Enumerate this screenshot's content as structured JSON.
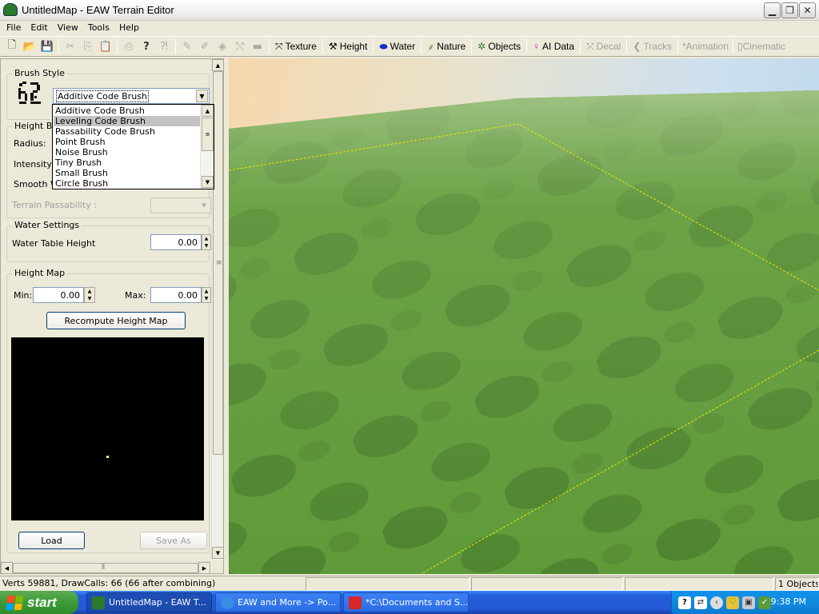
{
  "window": {
    "title": "UntitledMap - EAW Terrain Editor"
  },
  "menu": [
    "File",
    "Edit",
    "View",
    "Tools",
    "Help"
  ],
  "toolbar": {
    "mode_buttons": [
      {
        "label": "Texture",
        "icon": "texture-icon",
        "enabled": true
      },
      {
        "label": "Height",
        "icon": "height-icon",
        "enabled": true
      },
      {
        "label": "Water",
        "icon": "water-icon",
        "enabled": true
      },
      {
        "label": "Nature",
        "icon": "nature-icon",
        "enabled": true
      },
      {
        "label": "Objects",
        "icon": "objects-icon",
        "enabled": true
      },
      {
        "label": "AI Data",
        "icon": "ai-data-icon",
        "enabled": true
      },
      {
        "label": "Decal",
        "icon": "decal-icon",
        "enabled": false
      },
      {
        "label": "Tracks",
        "icon": "tracks-icon",
        "enabled": false
      },
      {
        "label": "Animation",
        "icon": "animation-icon",
        "enabled": false
      },
      {
        "label": "Cinematic",
        "icon": "cinematic-icon",
        "enabled": false
      }
    ]
  },
  "panel": {
    "brush_style": {
      "group_label": "Brush Style",
      "selected": "Additive Code Brush",
      "options": [
        "Additive Code Brush",
        "Leveling Code Brush",
        "Passability Code Brush",
        "Point Brush",
        "Noise Brush",
        "Tiny Brush",
        "Small Brush",
        "Circle Brush"
      ],
      "highlighted": "Leveling Code Brush"
    },
    "height_brush": {
      "group_label": "Height Bru",
      "radius_label": "Radius:",
      "intensity_label": "Intensity:",
      "smooth_label": "Smooth W",
      "passability_label": "Terrain Passability :"
    },
    "water": {
      "group_label": "Water Settings",
      "table_height_label": "Water Table Height",
      "table_height_value": "0.00"
    },
    "height_map": {
      "group_label": "Height Map",
      "min_label": "Min:",
      "min_value": "0.00",
      "max_label": "Max:",
      "max_value": "0.00",
      "recompute_label": "Recompute Height Map",
      "load_label": "Load",
      "save_as_label": "Save As"
    }
  },
  "status": {
    "verts": "Verts 59881, DrawCalls: 66 (66 after combining)",
    "objects": "1 Objects"
  },
  "taskbar": {
    "start_label": "start",
    "tasks": [
      "UntitledMap - EAW T...",
      "EAW and More -> Po...",
      "*C:\\Documents and S..."
    ],
    "clock": "9:38 PM"
  },
  "colors": {
    "terrain_green": "#5f9a3a",
    "selection_line": "#e8e400",
    "xp_blue": "#245edb"
  }
}
